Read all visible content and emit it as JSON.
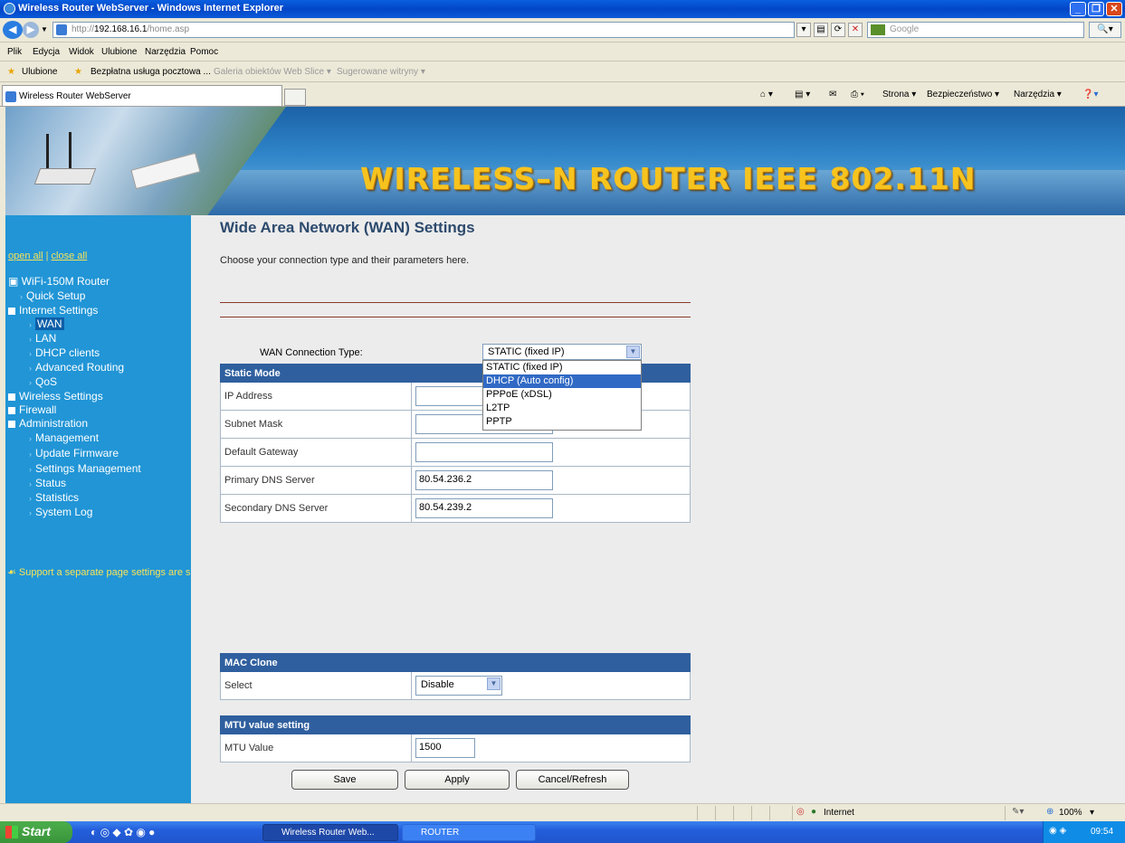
{
  "window": {
    "title": "Wireless Router WebServer - Windows Internet Explorer"
  },
  "address": {
    "url_prefix": "http://",
    "url_host": "192.168.16.1",
    "url_path": "/home.asp",
    "search_placeholder": "Google"
  },
  "menu": [
    "Plik",
    "Edycja",
    "Widok",
    "Ulubione",
    "Narzędzia",
    "Pomoc"
  ],
  "favorites": {
    "label": "Ulubione",
    "items": [
      "Bezpłatna usługa pocztowa ...",
      "Galeria obiektów Web Slice ▾",
      "Sugerowane witryny ▾"
    ]
  },
  "tab": {
    "title": "Wireless Router WebServer"
  },
  "command_bar": [
    "Strona ▾",
    "Bezpieczeństwo ▾",
    "Narzędzia ▾"
  ],
  "banner": {
    "title": "WIRELESS–N ROUTER  IEEE 802.11N"
  },
  "sidebar": {
    "open_all": "open all",
    "separator": "|",
    "close_all": "close all",
    "items": [
      {
        "label": "WiFi-150M Router"
      },
      {
        "label": "Quick Setup"
      },
      {
        "label": "Internet Settings"
      },
      {
        "label": "WAN"
      },
      {
        "label": "LAN"
      },
      {
        "label": "DHCP clients"
      },
      {
        "label": "Advanced Routing"
      },
      {
        "label": "QoS"
      },
      {
        "label": "Wireless Settings"
      },
      {
        "label": "Firewall"
      },
      {
        "label": "Administration"
      },
      {
        "label": "Management"
      },
      {
        "label": "Update Firmware"
      },
      {
        "label": "Settings Management"
      },
      {
        "label": "Status"
      },
      {
        "label": "Statistics"
      },
      {
        "label": "System Log"
      }
    ],
    "support_text": "Support a separate page settings are saved, Press the application button to take unified effect int the end!"
  },
  "main": {
    "title": "Wide Area Network (WAN) Settings",
    "description": "Choose your connection type and their parameters here.",
    "wan_type_label": "WAN Connection Type:",
    "wan_type_value": "STATIC (fixed IP)",
    "wan_type_options": [
      "STATIC (fixed IP)",
      "DHCP (Auto config)",
      "PPPoE (xDSL)",
      "L2TP",
      "PPTP"
    ],
    "static_mode": {
      "header": "Static Mode",
      "ip_label": "IP Address",
      "ip_value": "",
      "mask_label": "Subnet Mask",
      "mask_value": "",
      "gateway_label": "Default Gateway",
      "gateway_value": "",
      "dns1_label": "Primary DNS Server",
      "dns1_value": "80.54.236.2",
      "dns2_label": "Secondary DNS Server",
      "dns2_value": "80.54.239.2"
    },
    "mac_clone": {
      "header": "MAC Clone",
      "select_label": "Select",
      "select_value": "Disable"
    },
    "mtu": {
      "header": "MTU value setting",
      "label": "MTU Value",
      "value": "1500"
    },
    "buttons": {
      "save": "Save",
      "apply": "Apply",
      "cancel": "Cancel/Refresh"
    }
  },
  "statusbar": {
    "zone": "Internet",
    "zoom": "100%"
  },
  "taskbar": {
    "start": "Start",
    "task1": "Wireless Router Web...",
    "task2": "ROUTER",
    "clock": "09:54"
  }
}
